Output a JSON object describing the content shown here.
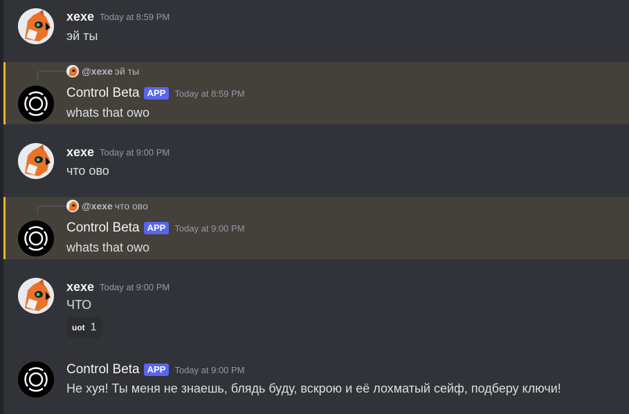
{
  "messages": [
    {
      "author": "xexe",
      "time": "Today at 8:59 PM",
      "content": "эй ты"
    },
    {
      "author": "Control Beta",
      "tag": "APP",
      "time": "Today at 8:59 PM",
      "content": "whats that owo",
      "reply": {
        "user": "@xexe",
        "text": "эй ты"
      }
    },
    {
      "author": "xexe",
      "time": "Today at 9:00 PM",
      "content": "что ово"
    },
    {
      "author": "Control Beta",
      "tag": "APP",
      "time": "Today at 9:00 PM",
      "content": "whats that owo",
      "reply": {
        "user": "@xexe",
        "text": "что ово"
      }
    },
    {
      "author": "xexe",
      "time": "Today at 9:00 PM",
      "content": "ЧТО",
      "reaction": {
        "emoji": "uot",
        "count": "1"
      }
    },
    {
      "author": "Control Beta",
      "tag": "APP",
      "time": "Today at 9:00 PM",
      "content": "Не хуя! Ты меня не знаешь, блядь буду, вскрою и её лохматый сейф, подберу ключи!"
    }
  ],
  "colors": {
    "background": "#313338",
    "mention_highlight": "#44403a",
    "mention_bar": "#f0b232",
    "app_tag": "#5865f2",
    "timestamp": "#949ba4"
  },
  "icons": {
    "user_avatar": "fox-avatar-icon",
    "bot_avatar": "control-ring-icon"
  }
}
